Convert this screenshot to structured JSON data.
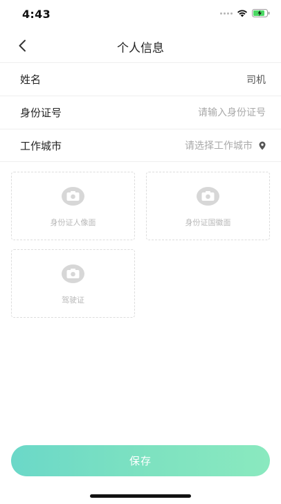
{
  "status_bar": {
    "time": "4:43"
  },
  "nav": {
    "title": "个人信息"
  },
  "form": {
    "name": {
      "label": "姓名",
      "value": "司机"
    },
    "id_number": {
      "label": "身份证号",
      "placeholder": "请输入身份证号"
    },
    "city": {
      "label": "工作城市",
      "placeholder": "请选择工作城市"
    }
  },
  "uploads": {
    "id_front": {
      "label": "身份证人像面"
    },
    "id_back": {
      "label": "身份证国徽面"
    },
    "license": {
      "label": "驾驶证"
    }
  },
  "actions": {
    "save_label": "保存"
  },
  "icons": [
    "chevron-left-icon",
    "location-pin-icon",
    "camera-icon",
    "wifi-icon",
    "battery-charging-icon"
  ],
  "colors": {
    "accent_start": "#6bd8c8",
    "accent_end": "#8ae9bf",
    "placeholder": "#a9a9a9"
  }
}
